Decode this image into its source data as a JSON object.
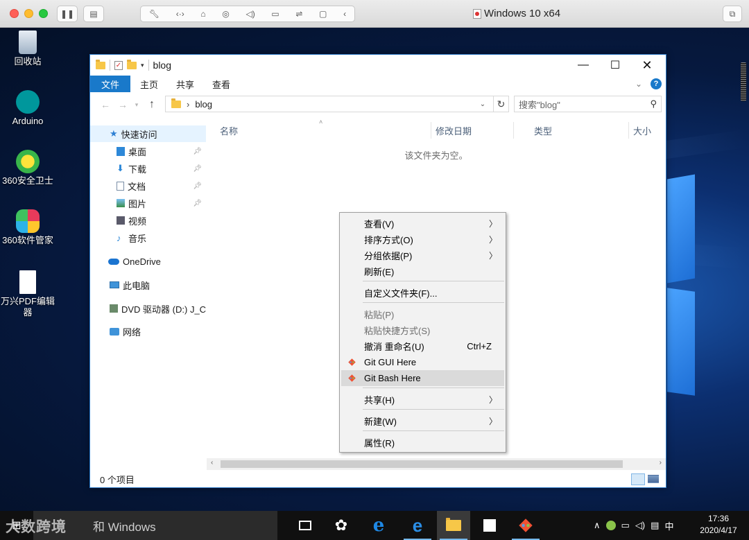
{
  "mac_window": {
    "title": "Windows 10 x64"
  },
  "desktop_icons": [
    {
      "label": "回收站"
    },
    {
      "label": "Arduino"
    },
    {
      "label": "360安全卫士"
    },
    {
      "label": "360软件管家"
    },
    {
      "label": "万兴PDF编辑器"
    }
  ],
  "explorer": {
    "title": "blog",
    "ribbon": {
      "file": "文件",
      "home": "主页",
      "share": "共享",
      "view": "查看"
    },
    "address": {
      "crumb_sep": "›",
      "path": "blog"
    },
    "search_placeholder": "搜索\"blog\"",
    "nav": {
      "quick_access": "快速访问",
      "desktop": "桌面",
      "downloads": "下载",
      "documents": "文档",
      "pictures": "图片",
      "videos": "视频",
      "music": "音乐",
      "onedrive": "OneDrive",
      "this_pc": "此电脑",
      "dvd": "DVD 驱动器 (D:) J_CC",
      "network": "网络"
    },
    "columns": {
      "name": "名称",
      "date": "修改日期",
      "type": "类型",
      "size": "大小"
    },
    "empty_text": "该文件夹为空。",
    "status": "0 个项目"
  },
  "context_menu": {
    "view": "查看(V)",
    "sort": "排序方式(O)",
    "group": "分组依据(P)",
    "refresh": "刷新(E)",
    "customize": "自定义文件夹(F)...",
    "paste": "粘贴(P)",
    "paste_shortcut": "粘贴快捷方式(S)",
    "undo": "撤消 重命名(U)",
    "undo_shortcut": "Ctrl+Z",
    "git_gui": "Git GUI Here",
    "git_bash": "Git Bash Here",
    "share": "共享(H)",
    "new": "新建(W)",
    "properties": "属性(R)"
  },
  "taskbar": {
    "search_text": "和 Windows",
    "ime": "中",
    "time": "17:36",
    "date": "2020/4/17"
  },
  "watermark": "大数跨境",
  "colors": {
    "accent": "#1979ca",
    "taskbar": "#101010"
  }
}
